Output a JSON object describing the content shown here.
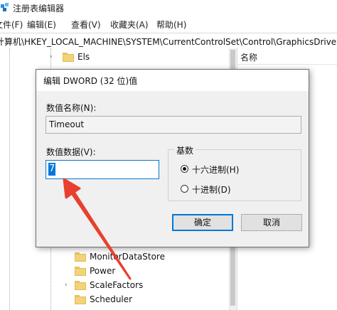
{
  "window": {
    "title": "注册表编辑器"
  },
  "menu": [
    "文件(F)",
    "编辑(E)",
    "查看(V)",
    "收藏夹(A)",
    "帮助(H)"
  ],
  "address": {
    "path": "计算机\\HKEY_LOCAL_MACHINE\\SYSTEM\\CurrentControlSet\\Control\\GraphicsDrivers"
  },
  "tree": {
    "items": [
      {
        "label": "Els"
      },
      {
        "label": "MonitorDataStore"
      },
      {
        "label": "Power"
      },
      {
        "label": "ScaleFactors"
      },
      {
        "label": "Scheduler"
      }
    ]
  },
  "right_pane": {
    "name_header": "名称"
  },
  "dialog": {
    "title": "编辑 DWORD (32 位)值",
    "value_name_label": "数值名称(N):",
    "value_name": "Timeout",
    "value_data_label": "数值数据(V):",
    "value_data": "7",
    "base_label": "基数",
    "hex_option": "十六进制(H)",
    "dec_option": "十进制(D)",
    "selected_base": "hex",
    "ok_label": "确定",
    "cancel_label": "取消"
  },
  "colors": {
    "accent": "#0078d7",
    "arrow": "#e8402f",
    "folder": "#f3d37a"
  }
}
